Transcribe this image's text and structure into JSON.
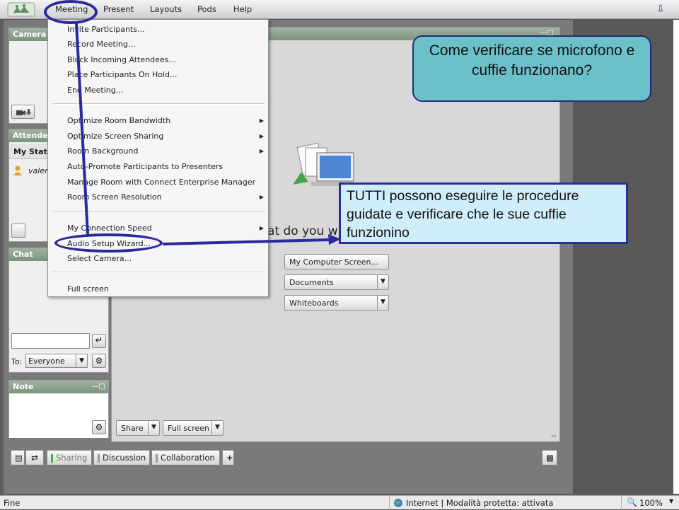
{
  "menubar": {
    "items": [
      "Meeting",
      "Present",
      "Layouts",
      "Pods",
      "Help"
    ]
  },
  "meeting_menu": {
    "group1": [
      "Invite Participants...",
      "Record Meeting...",
      "Block Incoming Attendees...",
      "Place Participants On Hold...",
      "End Meeting..."
    ],
    "group2": [
      "Optimize Room Bandwidth",
      "Optimize Screen Sharing",
      "Room Background",
      "Auto-Promote Participants to Presenters",
      "Manage Room with Connect Enterprise Manager",
      "Room Screen Resolution"
    ],
    "group3": [
      "My Connection Speed",
      "Audio Setup Wizard...",
      "Select Camera..."
    ],
    "group4": [
      "Full screen"
    ]
  },
  "pods": {
    "camera_title": "Camera",
    "attendee_title": "Attendee",
    "my_status": "My Statu",
    "attendee_name": "valer",
    "chat_title": "Chat",
    "chat_to_label": "To:",
    "chat_to_value": "Everyone",
    "note_title": "Note"
  },
  "share_pod": {
    "prompt_fragment": "at do you w",
    "my_computer_screen": "My Computer Screen...",
    "documents": "Documents",
    "whiteboards": "Whiteboards",
    "share_button": "Share",
    "full_screen_button": "Full screen"
  },
  "bottom_tabs": [
    "Sharing",
    "Discussion",
    "Collaboration"
  ],
  "callouts": {
    "question": "Come verificare  se microfono e cuffie funzionano?",
    "answer": "TUTTI possono eseguire le procedure guidate e verificare che le sue cuffie funzionino"
  },
  "statusbar": {
    "left": "Fine",
    "zone": "Internet | Modalità protetta: attivata",
    "zoom": "100%"
  },
  "colors": {
    "annotation_blue": "#2a2a9c",
    "callout_teal": "#6cc1c9",
    "callout_light": "#cfeefa"
  }
}
